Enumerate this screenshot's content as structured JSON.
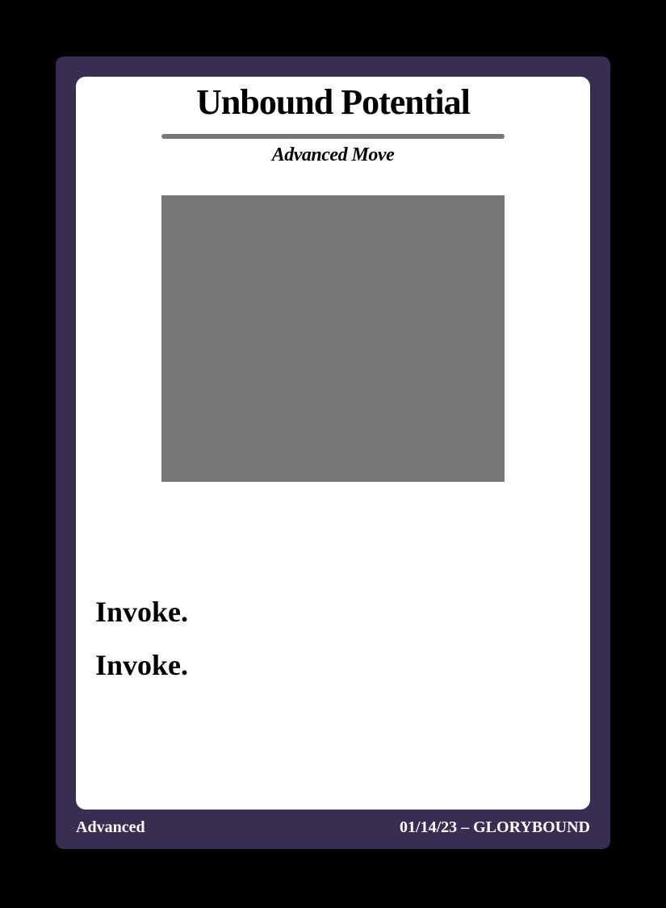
{
  "card": {
    "title": "Unbound Potential",
    "subtitle": "Advanced Move",
    "body_lines": [
      "Invoke.",
      "Invoke."
    ],
    "footer_left": "Advanced",
    "footer_right": "01/14/23 – GLORYBOUND",
    "colors": {
      "frame": "#372e52",
      "panel": "#ffffff",
      "art_placeholder": "#777777"
    }
  }
}
